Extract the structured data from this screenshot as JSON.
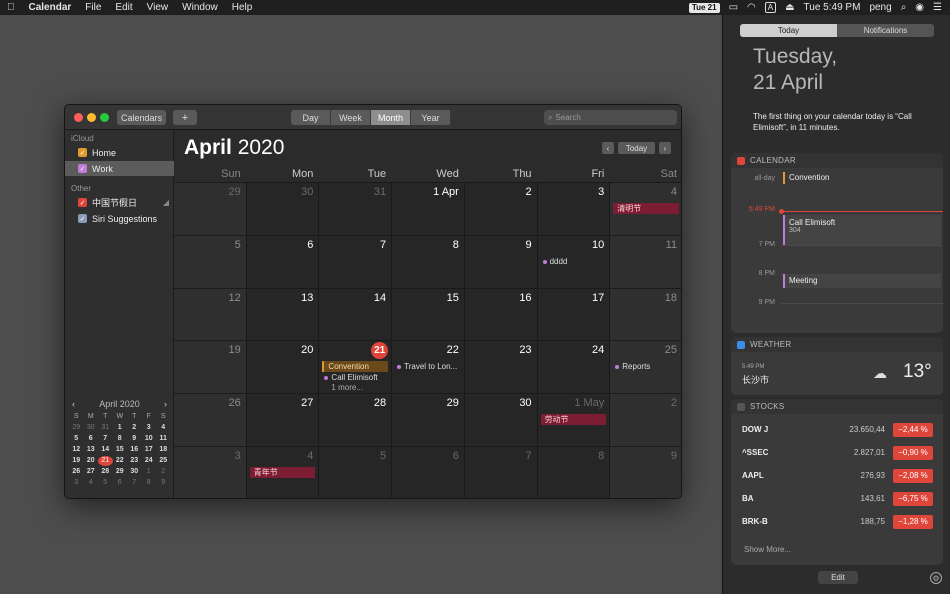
{
  "menubar": {
    "app_name": "Calendar",
    "menus": [
      "File",
      "Edit",
      "View",
      "Window",
      "Help"
    ],
    "date_badge": "Tue 21",
    "input_badge": "A",
    "clock": "Tue 5:49 PM",
    "user": "peng"
  },
  "toolbar": {
    "calendars_label": "Calendars",
    "add_label": "+",
    "views": [
      "Day",
      "Week",
      "Month",
      "Year"
    ],
    "selected_view": "Month",
    "search_placeholder": "Search"
  },
  "sidebar": {
    "icloud_header": "iCloud",
    "other_header": "Other",
    "calendars": [
      {
        "label": "Home",
        "color": "#e09a2d"
      },
      {
        "label": "Work",
        "color": "#c17bd8"
      }
    ],
    "other_calendars": [
      {
        "label": "中国节假日",
        "color": "#e0453a"
      },
      {
        "label": "Siri Suggestions",
        "color": "#8a9ab8"
      }
    ]
  },
  "mini_calendar": {
    "title": "April 2020",
    "prev": "‹",
    "next": "›",
    "day_names": [
      "S",
      "M",
      "T",
      "W",
      "T",
      "F",
      "S"
    ],
    "weeks": [
      [
        "29",
        "30",
        "31",
        "1",
        "2",
        "3",
        "4"
      ],
      [
        "5",
        "6",
        "7",
        "8",
        "9",
        "10",
        "11"
      ],
      [
        "12",
        "13",
        "14",
        "15",
        "16",
        "17",
        "18"
      ],
      [
        "19",
        "20",
        "21",
        "22",
        "23",
        "24",
        "25"
      ],
      [
        "26",
        "27",
        "28",
        "29",
        "30",
        "1",
        "2"
      ],
      [
        "3",
        "4",
        "5",
        "6",
        "7",
        "8",
        "9"
      ]
    ]
  },
  "calendar": {
    "month_name": "April",
    "year": "2020",
    "today_button": "Today",
    "prev": "‹",
    "next": "›",
    "day_headers": [
      "Sun",
      "Mon",
      "Tue",
      "Wed",
      "Thu",
      "Fri",
      "Sat"
    ],
    "weeks": [
      [
        "29",
        "30",
        "31",
        "1 Apr",
        "2",
        "3",
        "4"
      ],
      [
        "5",
        "6",
        "7",
        "8",
        "9",
        "10",
        "11"
      ],
      [
        "12",
        "13",
        "14",
        "15",
        "16",
        "17",
        "18"
      ],
      [
        "19",
        "20",
        "21",
        "22",
        "23",
        "24",
        "25"
      ],
      [
        "26",
        "27",
        "28",
        "29",
        "30",
        "1 May",
        "2"
      ],
      [
        "3",
        "4",
        "5",
        "6",
        "7",
        "8",
        "9"
      ]
    ],
    "events": {
      "qingming": "清明节",
      "dddd": "dddd",
      "convention": "Convention",
      "call": "Call Elimisoft",
      "more": "1 more...",
      "travel": "Travel to Lon...",
      "reports": "Reports",
      "labor": "劳动节",
      "youth": "青年节"
    }
  },
  "notification_center": {
    "tab_today": "Today",
    "tab_notifications": "Notifications",
    "date_line1": "Tuesday,",
    "date_line2": "21 April",
    "summary": "The first thing on your calendar today is “Call Elimisoft”, in 11 minutes.",
    "calendar_widget": {
      "title": "CALENDAR",
      "allday_label": "all-day",
      "allday_event": "Convention",
      "now_time": "5:49 PM",
      "times": [
        "7 PM",
        "8 PM",
        "9 PM"
      ],
      "event1_title": "Call Elimisoft",
      "event1_sub": "304",
      "event2_title": "Meeting"
    },
    "weather_widget": {
      "title": "WEATHER",
      "time": "5:49 PM",
      "city": "长沙市",
      "temp": "13°"
    },
    "stocks_widget": {
      "title": "STOCKS",
      "rows": [
        {
          "symbol": "DOW J",
          "price": "23.650,44",
          "change": "−2,44 %"
        },
        {
          "symbol": "^SSEC",
          "price": "2.827,01",
          "change": "−0,90 %"
        },
        {
          "symbol": "AAPL",
          "price": "276,93",
          "change": "−2,08 %"
        },
        {
          "symbol": "BA",
          "price": "143,61",
          "change": "−6,75 %"
        },
        {
          "symbol": "BRK-B",
          "price": "188,75",
          "change": "−1,28 %"
        }
      ],
      "show_more": "Show More..."
    },
    "edit_label": "Edit"
  }
}
